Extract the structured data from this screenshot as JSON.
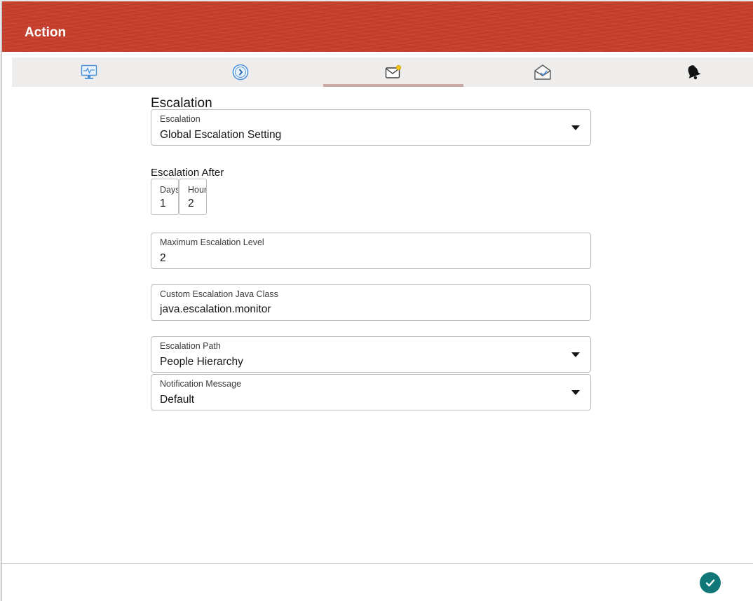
{
  "header": {
    "title": "Action"
  },
  "tabs": [
    {
      "icon": "monitor-icon"
    },
    {
      "icon": "clock-icon"
    },
    {
      "icon": "mail-notification-icon",
      "active": true
    },
    {
      "icon": "open-envelope-icon"
    },
    {
      "icon": "bell-icon"
    }
  ],
  "form": {
    "section_title": "Escalation",
    "escalation": {
      "label": "Escalation",
      "value": "Global Escalation Setting"
    },
    "escalation_after": {
      "label": "Escalation After",
      "days": {
        "label": "Days",
        "value": "1"
      },
      "hours": {
        "label": "Hours",
        "value": "2"
      }
    },
    "max_level": {
      "label": "Maximum Escalation Level",
      "value": "2"
    },
    "java_class": {
      "label": "Custom Escalation Java Class",
      "value": "java.escalation.monitor"
    },
    "path": {
      "label": "Escalation Path",
      "value": "People Hierarchy"
    },
    "message": {
      "label": "Notification Message",
      "value": "Default"
    }
  },
  "colors": {
    "header": "#c7412f",
    "tabbar": "#eeedeb",
    "tab_indicator": "#c9a9a6",
    "confirm_button": "#0f7777"
  },
  "footer": {
    "confirm_icon": "checkmark-icon"
  }
}
